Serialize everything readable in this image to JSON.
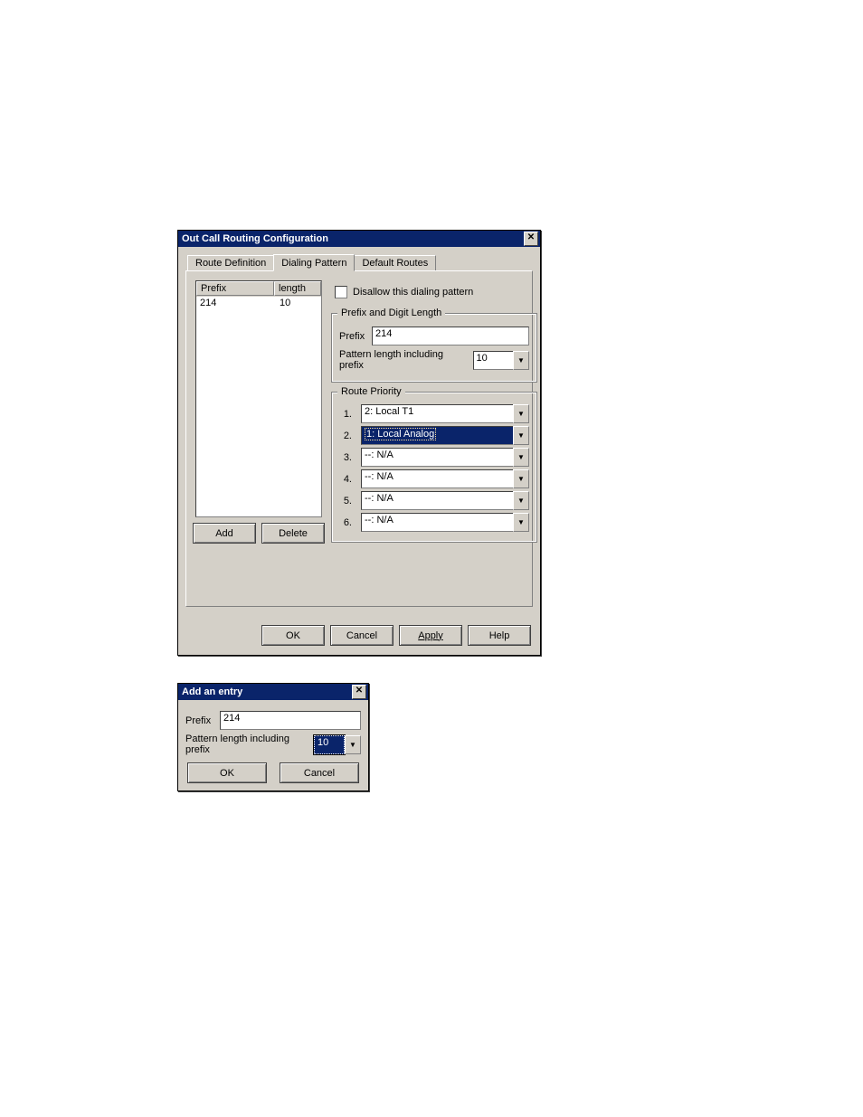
{
  "mainDialog": {
    "title": "Out Call Routing Configuration",
    "tabs": {
      "routeDef": "Route Definition",
      "dialing": "Dialing Pattern",
      "defaultRoutes": "Default Routes"
    },
    "list": {
      "headers": {
        "prefix": "Prefix",
        "length": "length"
      },
      "rows": [
        {
          "prefix": "214",
          "length": "10"
        }
      ]
    },
    "btnAdd": "Add",
    "btnDelete": "Delete",
    "disallow": "Disallow this dialing pattern",
    "prefixGroup": {
      "legend": "Prefix and Digit Length",
      "prefixLabel": "Prefix",
      "prefixValue": "214",
      "patternLabel": "Pattern length including prefix",
      "patternValue": "10"
    },
    "priorityGroup": {
      "legend": "Route Priority",
      "items": [
        {
          "num": "1.",
          "value": "2: Local T1"
        },
        {
          "num": "2.",
          "value": "1: Local Analog",
          "highlight": true
        },
        {
          "num": "3.",
          "value": "--: N/A"
        },
        {
          "num": "4.",
          "value": "--: N/A"
        },
        {
          "num": "5.",
          "value": "--: N/A"
        },
        {
          "num": "6.",
          "value": "--: N/A"
        }
      ]
    },
    "footer": {
      "ok": "OK",
      "cancel": "Cancel",
      "apply": "Apply",
      "help": "Help"
    }
  },
  "addDialog": {
    "title": "Add an entry",
    "prefixLabel": "Prefix",
    "prefixValue": "214",
    "patternLabel": "Pattern length including prefix",
    "patternValue": "10",
    "ok": "OK",
    "cancel": "Cancel"
  },
  "glyphs": {
    "down": "▼",
    "close": "✕"
  }
}
